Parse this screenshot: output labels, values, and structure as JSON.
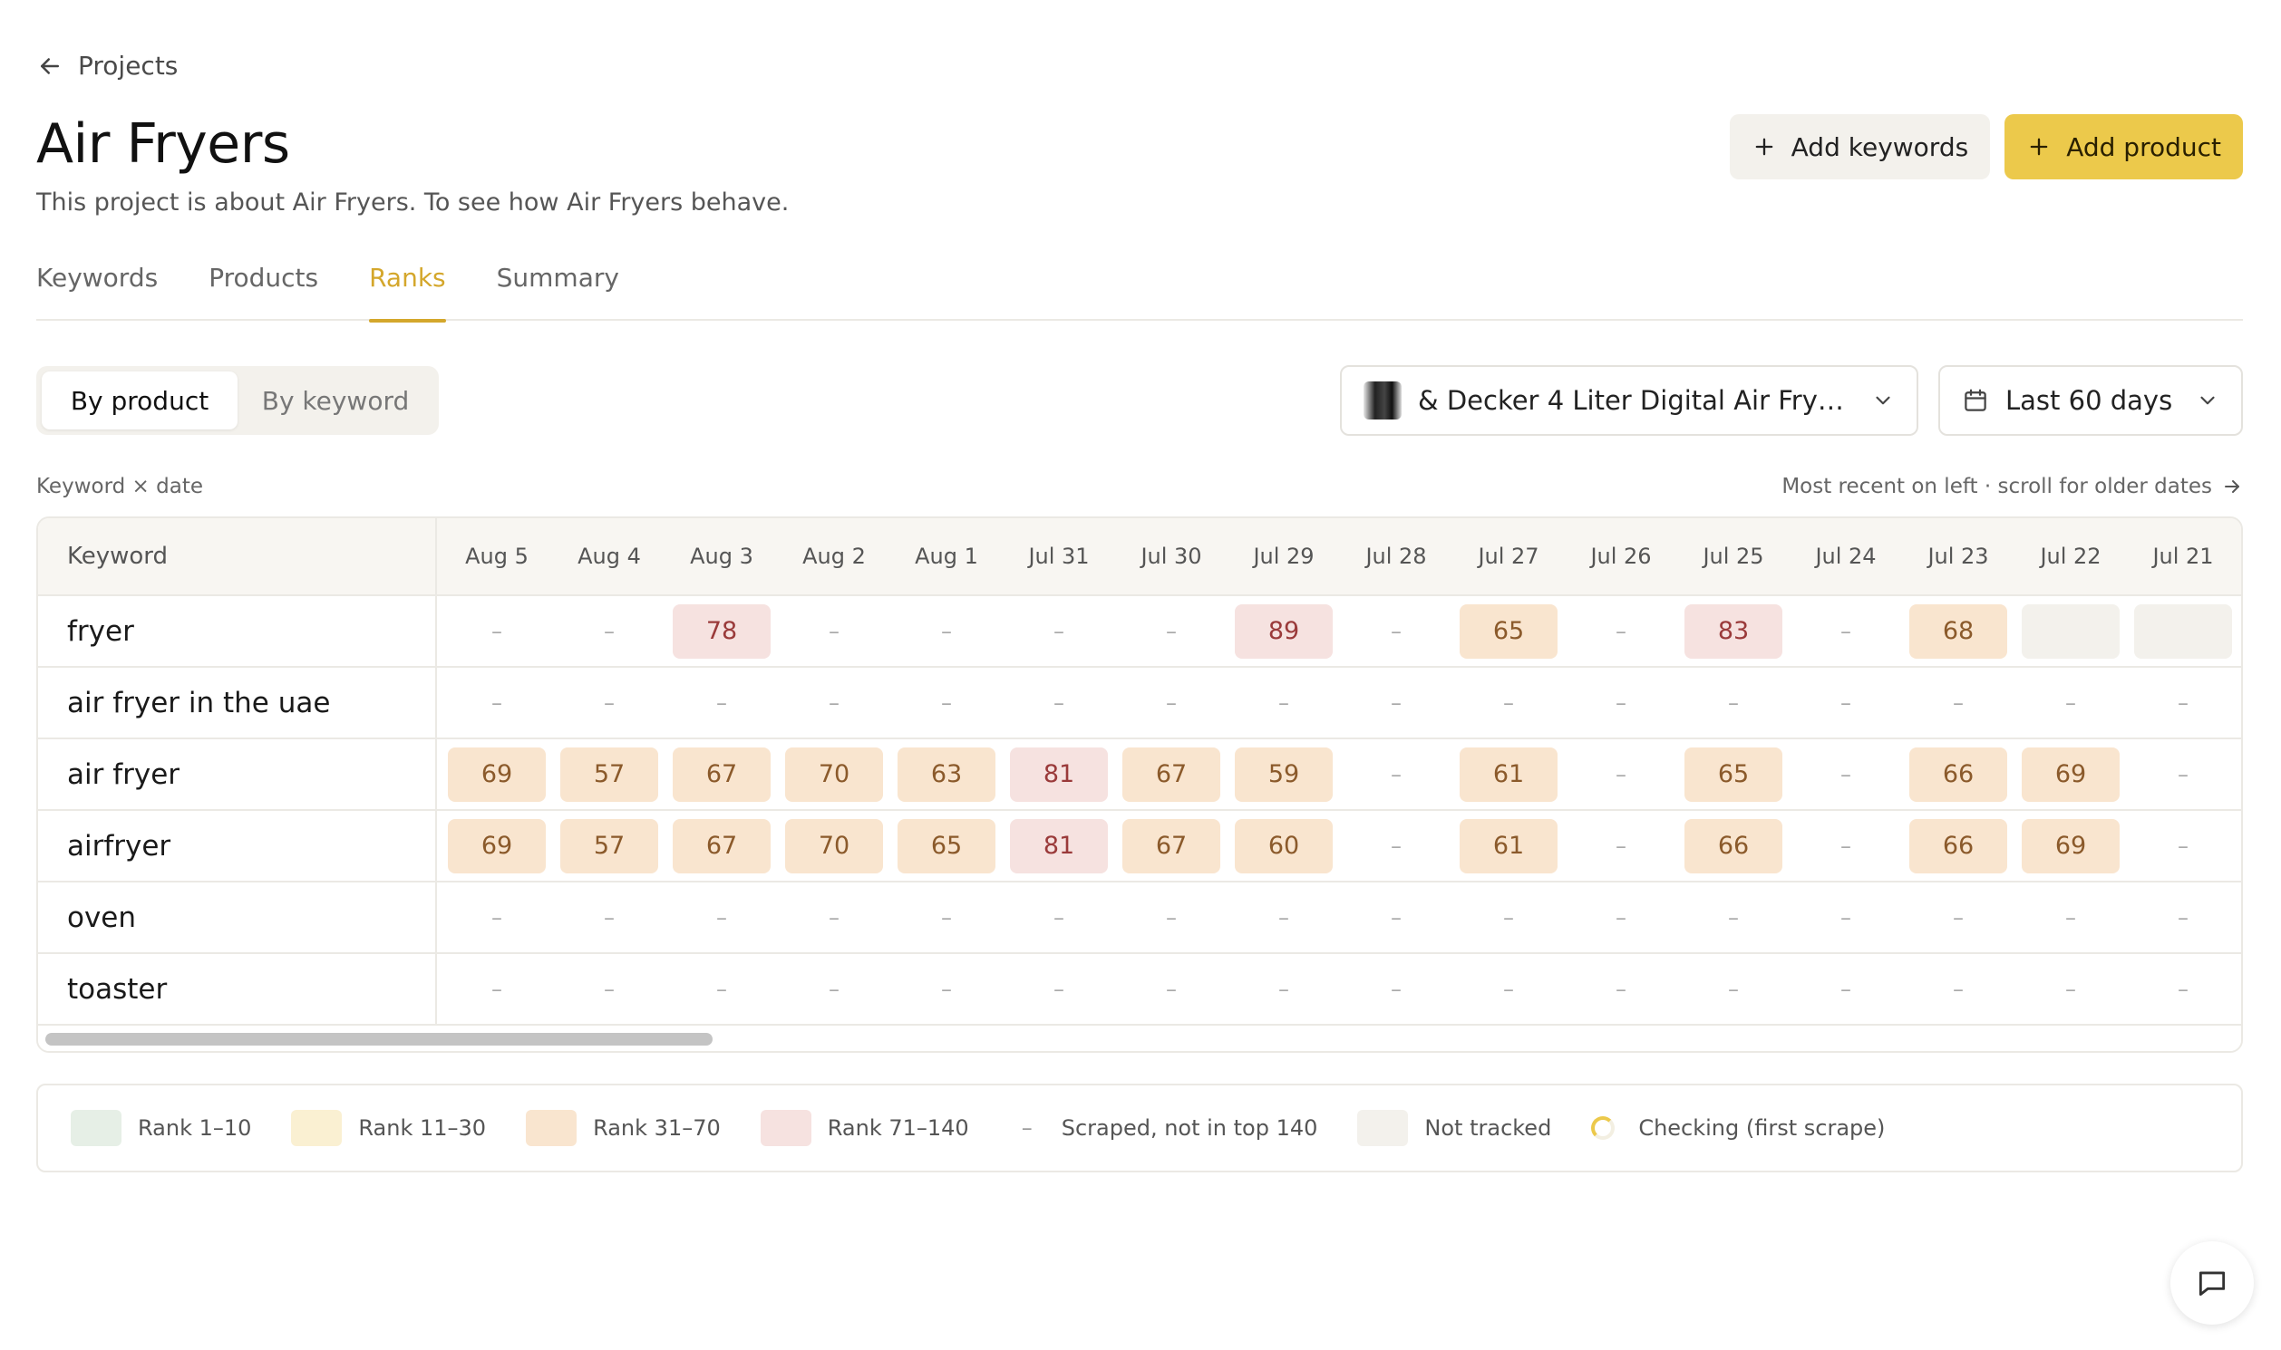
{
  "nav": {
    "back_label": "Projects"
  },
  "project": {
    "title": "Air Fryers",
    "description": "This project is about Air Fryers. To see how Air Fryers behave."
  },
  "actions": {
    "add_keywords": "Add keywords",
    "add_product": "Add product"
  },
  "tabs": [
    {
      "label": "Keywords",
      "active": false
    },
    {
      "label": "Products",
      "active": false
    },
    {
      "label": "Ranks",
      "active": true
    },
    {
      "label": "Summary",
      "active": false
    }
  ],
  "view_toggle": {
    "by_product": "By product",
    "by_keyword": "By keyword",
    "selected": "By product"
  },
  "product_select": {
    "value": "& Decker 4 Liter Digital Air Fryer..."
  },
  "range_select": {
    "value": "Last 60 days"
  },
  "grid": {
    "caption": "Keyword × date",
    "scroll_hint": "Most recent on left · scroll for older dates",
    "keyword_header": "Keyword",
    "dates": [
      "Aug 5",
      "Aug 4",
      "Aug 3",
      "Aug 2",
      "Aug 1",
      "Jul 31",
      "Jul 30",
      "Jul 29",
      "Jul 28",
      "Jul 27",
      "Jul 26",
      "Jul 25",
      "Jul 24",
      "Jul 23",
      "Jul 22",
      "Jul 21"
    ],
    "rows": [
      {
        "keyword": "fryer",
        "ranks": [
          "-",
          "-",
          "78",
          "-",
          "-",
          "-",
          "-",
          "89",
          "-",
          "65",
          "-",
          "83",
          "-",
          "68",
          "NT",
          "NT"
        ]
      },
      {
        "keyword": "air fryer in the uae",
        "ranks": [
          "-",
          "-",
          "-",
          "-",
          "-",
          "-",
          "-",
          "-",
          "-",
          "-",
          "-",
          "-",
          "-",
          "-",
          "-",
          "-"
        ]
      },
      {
        "keyword": "air fryer",
        "ranks": [
          "69",
          "57",
          "67",
          "70",
          "63",
          "81",
          "67",
          "59",
          "-",
          "61",
          "-",
          "65",
          "-",
          "66",
          "69",
          "-"
        ]
      },
      {
        "keyword": "airfryer",
        "ranks": [
          "69",
          "57",
          "67",
          "70",
          "65",
          "81",
          "67",
          "60",
          "-",
          "61",
          "-",
          "66",
          "-",
          "66",
          "69",
          "-"
        ]
      },
      {
        "keyword": "oven",
        "ranks": [
          "-",
          "-",
          "-",
          "-",
          "-",
          "-",
          "-",
          "-",
          "-",
          "-",
          "-",
          "-",
          "-",
          "-",
          "-",
          "-"
        ]
      },
      {
        "keyword": "toaster",
        "ranks": [
          "-",
          "-",
          "-",
          "-",
          "-",
          "-",
          "-",
          "-",
          "-",
          "-",
          "-",
          "-",
          "-",
          "-",
          "-",
          "-"
        ]
      }
    ]
  },
  "legend": {
    "rank_1_10": "Rank 1–10",
    "rank_11_30": "Rank 11–30",
    "rank_31_70": "Rank 31–70",
    "rank_71_140": "Rank 71–140",
    "dash_symbol": "–",
    "scraped": "Scraped, not in top 140",
    "not_tracked": "Not tracked",
    "checking": "Checking (first scrape)"
  },
  "colors": {
    "accent": "#d4a72c",
    "primary_button": "#ecc94b",
    "rank_1_10": "#e6efe6",
    "rank_11_30": "#faf0d2",
    "rank_31_70": "#f9e5cf",
    "rank_71_140": "#f6e2e0",
    "not_tracked": "#f3f1ec"
  }
}
